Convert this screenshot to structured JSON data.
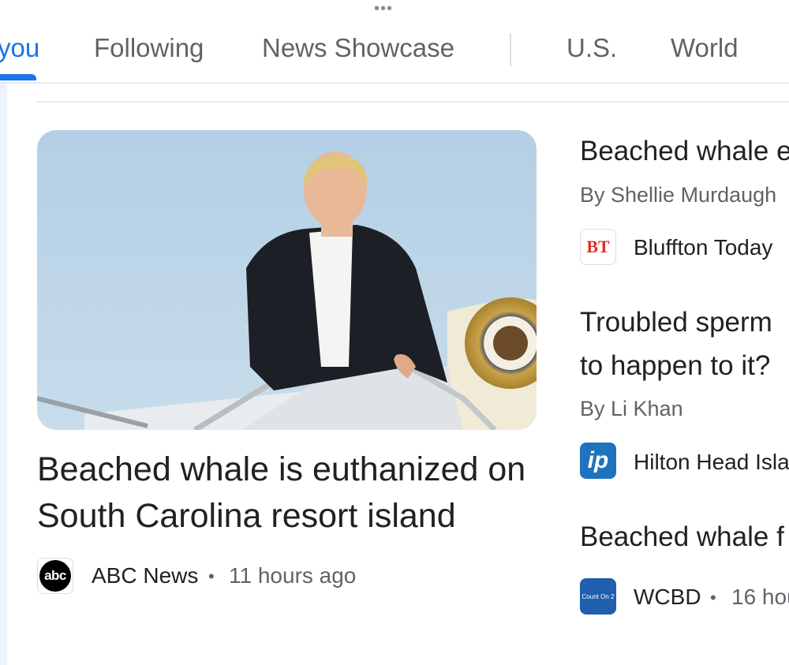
{
  "top_menu": {
    "icon": "more-horizontal-icon",
    "glyph": "•••"
  },
  "tabs": [
    {
      "label": "you",
      "active": true
    },
    {
      "label": "Following"
    },
    {
      "label": "News Showcase"
    },
    {
      "label": "U.S."
    },
    {
      "label": "World"
    }
  ],
  "main_story": {
    "title": "Beached whale is euthanized on South Carolina resort island",
    "source": "ABC News",
    "source_logo_text": "abc",
    "time": "11 hours ago",
    "separator": "•"
  },
  "side_stories": [
    {
      "title": "Beached whale e",
      "byline": "By Shellie Murdaugh",
      "source": "Bluffton Today",
      "source_logo_text": "BT"
    },
    {
      "title_line1": "Troubled sperm",
      "title_line2": "to happen to it?",
      "byline": "By Li Khan",
      "source": "Hilton Head Isla",
      "source_logo_text": "ip"
    },
    {
      "title": "Beached whale f",
      "source": "WCBD",
      "source_logo_text": "Count On 2",
      "time": "16 hou",
      "separator": "•"
    }
  ],
  "colors": {
    "accent": "#1a73e8",
    "text": "#202124",
    "muted": "#5f6368"
  }
}
